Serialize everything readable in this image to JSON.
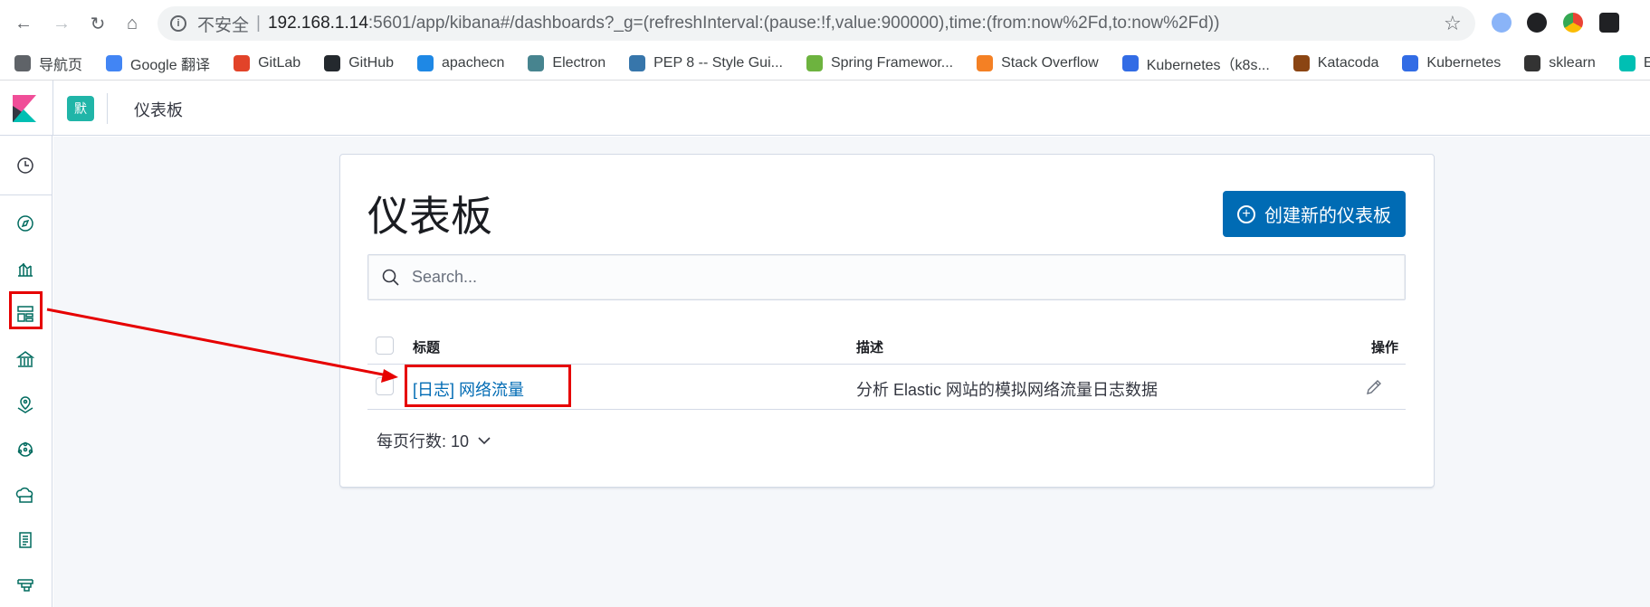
{
  "browser": {
    "insecure_label": "不安全",
    "separator": "|",
    "url_host": "192.168.1.14",
    "url_path": ":5601/app/kibana#/dashboards?_g=(refreshInterval:(pause:!f,value:900000),time:(from:now%2Fd,to:now%2Fd))",
    "bookmarks": [
      {
        "label": "导航页",
        "color": "#5f6368"
      },
      {
        "label": "Google 翻译",
        "color": "#4285f4"
      },
      {
        "label": "GitLab",
        "color": "#e24329"
      },
      {
        "label": "GitHub",
        "color": "#24292e"
      },
      {
        "label": "apachecn",
        "color": "#1e88e5"
      },
      {
        "label": "Electron",
        "color": "#47848f"
      },
      {
        "label": "PEP 8 -- Style Gui...",
        "color": "#3776ab"
      },
      {
        "label": "Spring Framewor...",
        "color": "#6db33f"
      },
      {
        "label": "Stack Overflow",
        "color": "#f48024"
      },
      {
        "label": "Kubernetes（k8s...",
        "color": "#326ce5"
      },
      {
        "label": "Katacoda",
        "color": "#8b4513"
      },
      {
        "label": "Kubernetes",
        "color": "#326ce5"
      },
      {
        "label": "sklearn",
        "color": "#333333"
      },
      {
        "label": "Elast",
        "color": "#00bfb3"
      }
    ]
  },
  "kibana": {
    "space_avatar": "默",
    "breadcrumb": "仪表板",
    "page_title": "仪表板",
    "create_button": "创建新的仪表板",
    "search_placeholder": "Search...",
    "table": {
      "headers": {
        "title": "标题",
        "description": "描述",
        "actions": "操作"
      },
      "rows": [
        {
          "title": "[日志] 网络流量",
          "description": "分析 Elastic 网站的模拟网络流量日志数据"
        }
      ]
    },
    "rows_per_page": "每页行数: 10"
  },
  "colors": {
    "accent": "#006bb4",
    "annotation": "#e60000",
    "avatar": "#20b5a8"
  }
}
